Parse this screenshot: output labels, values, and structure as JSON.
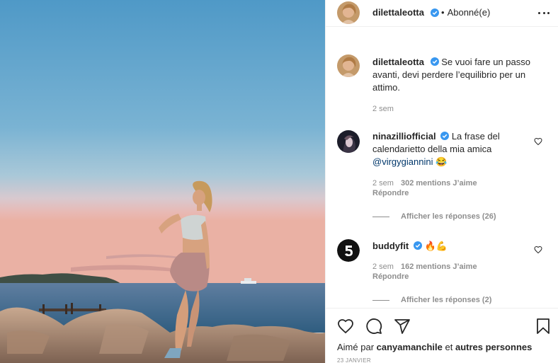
{
  "post": {
    "username": "dilettaleotta",
    "follow_state": "Abonné(e)",
    "separator": "•",
    "caption_user": "dilettaleotta",
    "caption_text": "Se vuoi fare un passo avanti, devi perdere l’equilibrio per un attimo.",
    "caption_time": "2 sem"
  },
  "comments": [
    {
      "user": "ninazilliofficial",
      "text": "La frase del calendarietto della mia amica",
      "mention": "@virgygiannini",
      "emoji": "😂",
      "time": "2 sem",
      "likes": "302 mentions J’aime",
      "reply_label": "Répondre",
      "view_replies": "Afficher les réponses (26)"
    },
    {
      "user": "buddyfit",
      "emoji": "🔥💪",
      "time": "2 sem",
      "likes": "162 mentions J’aime",
      "reply_label": "Répondre",
      "view_replies": "Afficher les réponses (2)"
    }
  ],
  "footer": {
    "liked_by_prefix": "Aimé par",
    "liked_by_user": "canyamanchile",
    "liked_by_and": "et",
    "liked_by_others": "autres personnes",
    "date": "23 JANVIER"
  },
  "icons": {
    "more": "more-options-icon",
    "like": "heart-icon",
    "comment": "comment-icon",
    "share": "share-icon",
    "save": "bookmark-icon",
    "verified": "verified-badge-icon"
  },
  "colors": {
    "verified": "#3897f0",
    "text": "#262626",
    "muted": "#8e8e8e",
    "mention": "#00376b"
  }
}
